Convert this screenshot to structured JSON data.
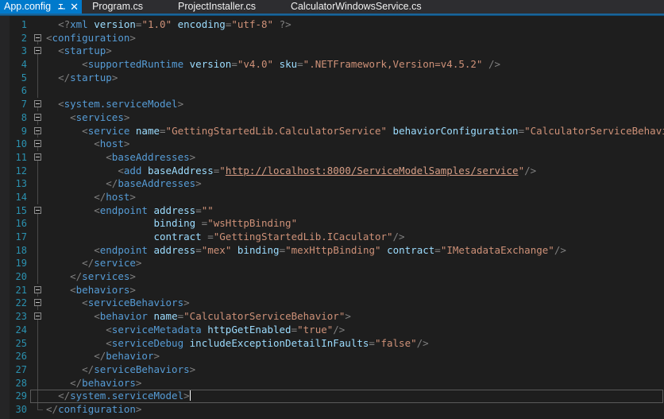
{
  "tabs": [
    {
      "label": "App.config",
      "active": true,
      "pin_icon": "pin-icon",
      "close_icon": "close-icon"
    },
    {
      "label": "Program.cs",
      "active": false
    },
    {
      "label": "ProjectInstaller.cs",
      "active": false
    },
    {
      "label": "CalculatorWindowsService.cs",
      "active": false
    }
  ],
  "editor": {
    "filename": "App.config",
    "language": "xml",
    "cursor_line": 29,
    "colors": {
      "background": "#1e1e1e",
      "tab_active": "#007acc",
      "tab_bar": "#2d2d30",
      "line_number": "#2b91af",
      "tag": "#569cd6",
      "attribute": "#9cdcfe",
      "value": "#ce9178",
      "punctuation": "#808080"
    },
    "lines": [
      {
        "n": 1,
        "fold": "none",
        "text": "  <?xml version=\"1.0\" encoding=\"utf-8\" ?>"
      },
      {
        "n": 2,
        "fold": "box",
        "text": "<configuration>"
      },
      {
        "n": 3,
        "fold": "box",
        "text": "  <startup>"
      },
      {
        "n": 4,
        "fold": "line",
        "text": "      <supportedRuntime version=\"v4.0\" sku=\".NETFramework,Version=v4.5.2\" />"
      },
      {
        "n": 5,
        "fold": "line",
        "text": "  </startup>"
      },
      {
        "n": 6,
        "fold": "line",
        "text": ""
      },
      {
        "n": 7,
        "fold": "box",
        "text": "  <system.serviceModel>"
      },
      {
        "n": 8,
        "fold": "box",
        "text": "    <services>"
      },
      {
        "n": 9,
        "fold": "box",
        "text": "      <service name=\"GettingStartedLib.CalculatorService\" behaviorConfiguration=\"CalculatorServiceBehavior\">"
      },
      {
        "n": 10,
        "fold": "box",
        "text": "        <host>"
      },
      {
        "n": 11,
        "fold": "box",
        "text": "          <baseAddresses>"
      },
      {
        "n": 12,
        "fold": "line",
        "text": "            <add baseAddress=\"http://localhost:8000/ServiceModelSamples/service\"/>"
      },
      {
        "n": 13,
        "fold": "line",
        "text": "          </baseAddresses>"
      },
      {
        "n": 14,
        "fold": "line",
        "text": "        </host>"
      },
      {
        "n": 15,
        "fold": "box",
        "text": "        <endpoint address=\"\""
      },
      {
        "n": 16,
        "fold": "line",
        "text": "                  binding =\"wsHttpBinding\""
      },
      {
        "n": 17,
        "fold": "line",
        "text": "                  contract =\"GettingStartedLib.ICaculator\"/>"
      },
      {
        "n": 18,
        "fold": "line",
        "text": "        <endpoint address=\"mex\" binding=\"mexHttpBinding\" contract=\"IMetadataExchange\"/>"
      },
      {
        "n": 19,
        "fold": "line",
        "text": "      </service>"
      },
      {
        "n": 20,
        "fold": "line",
        "text": "    </services>"
      },
      {
        "n": 21,
        "fold": "box",
        "text": "    <behaviors>"
      },
      {
        "n": 22,
        "fold": "box",
        "text": "      <serviceBehaviors>"
      },
      {
        "n": 23,
        "fold": "box",
        "text": "        <behavior name=\"CalculatorServiceBehavior\">"
      },
      {
        "n": 24,
        "fold": "line",
        "text": "          <serviceMetadata httpGetEnabled=\"true\"/>"
      },
      {
        "n": 25,
        "fold": "line",
        "text": "          <serviceDebug includeExceptionDetailInFaults=\"false\"/>"
      },
      {
        "n": 26,
        "fold": "line",
        "text": "        </behavior>"
      },
      {
        "n": 27,
        "fold": "line",
        "text": "      </serviceBehaviors>"
      },
      {
        "n": 28,
        "fold": "line",
        "text": "    </behaviors>"
      },
      {
        "n": 29,
        "fold": "line",
        "text": "  </system.serviceModel>",
        "current": true
      },
      {
        "n": 30,
        "fold": "end",
        "text": "</configuration>"
      }
    ]
  }
}
